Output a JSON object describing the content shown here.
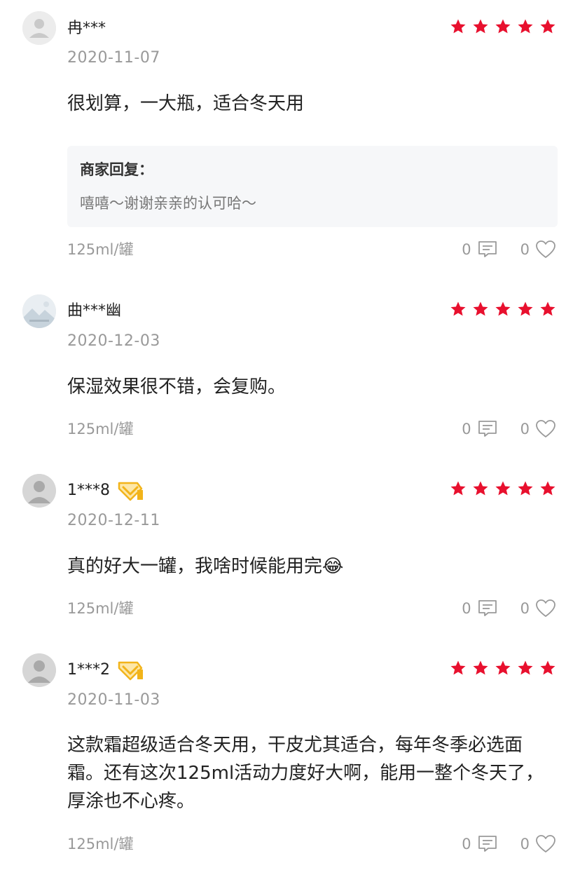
{
  "colors": {
    "star": "#e8102e",
    "vip_gold": "#f2b41a",
    "date": "#999999"
  },
  "reviews": [
    {
      "user": "冉***",
      "avatar": "default-avatar-icon",
      "vip": false,
      "rating": 5,
      "date": "2020-11-07",
      "text": "很划算，一大瓶，适合冬天用",
      "reply": {
        "title": "商家回复：",
        "text": "嘻嘻～谢谢亲亲的认可哈～"
      },
      "spec": "125ml/罐",
      "comments": "0",
      "likes": "0"
    },
    {
      "user": "曲***幽",
      "avatar": "landscape-avatar-icon",
      "vip": false,
      "rating": 5,
      "date": "2020-12-03",
      "text": "保湿效果很不错，会复购。",
      "spec": "125ml/罐",
      "comments": "0",
      "likes": "0"
    },
    {
      "user": "1***8",
      "avatar": "default-avatar-icon",
      "vip": true,
      "rating": 5,
      "date": "2020-12-11",
      "text": "真的好大一罐，我啥时候能用完😂",
      "spec": "125ml/罐",
      "comments": "0",
      "likes": "0"
    },
    {
      "user": "1***2",
      "avatar": "default-avatar-icon",
      "vip": true,
      "rating": 5,
      "date": "2020-11-03",
      "text": "这款霜超级适合冬天用，干皮尤其适合，每年冬季必选面霜。还有这次125ml活动力度好大啊，能用一整个冬天了，厚涂也不心疼。",
      "spec": "125ml/罐",
      "comments": "0",
      "likes": "0"
    }
  ]
}
